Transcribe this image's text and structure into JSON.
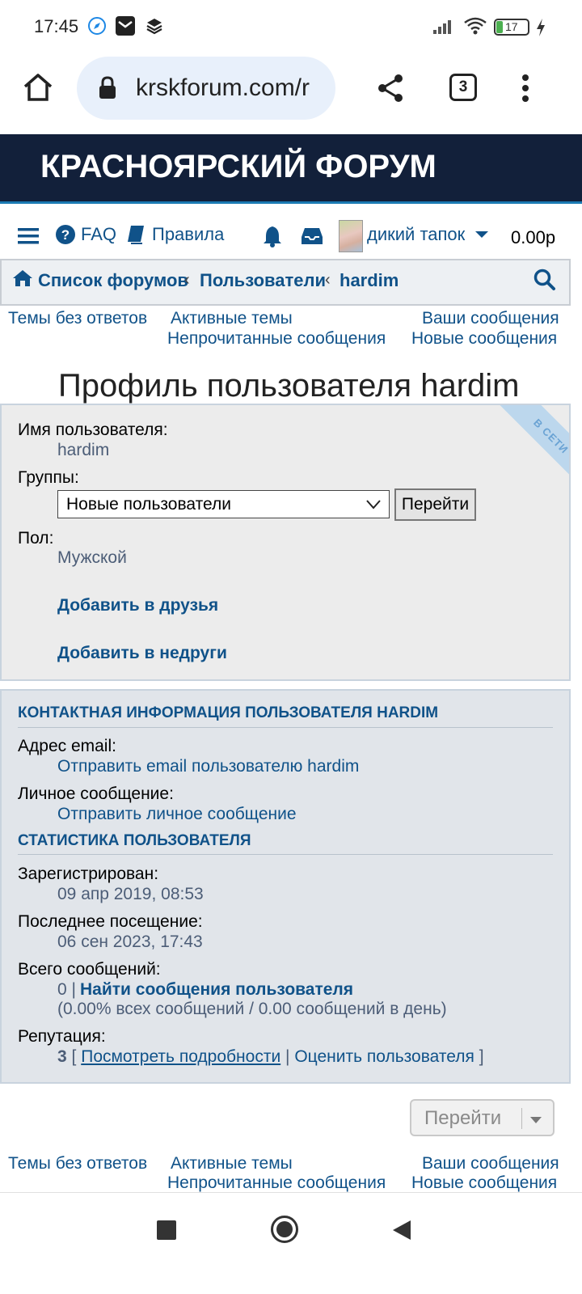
{
  "status_bar": {
    "time": "17:45",
    "battery": "17"
  },
  "browser": {
    "url": "krskforum.com/r",
    "tab_count": "3"
  },
  "forum": {
    "title": "КРАСНОЯРСКИЙ ФОРУМ"
  },
  "nav": {
    "faq": "FAQ",
    "rules": "Правила",
    "username": "дикий тапок",
    "balance": "0.00р"
  },
  "breadcrumb": {
    "home": "Список форумов",
    "sep": "‹",
    "users": "Пользователи",
    "current": "hardim"
  },
  "quick_links": {
    "unanswered": "Темы без ответов",
    "active": "Активные темы",
    "your_posts": "Ваши сообщения",
    "unread": "Непрочитанные сообщения",
    "new_posts": "Новые сообщения"
  },
  "profile": {
    "title": "Профиль пользователя hardim",
    "online_badge": "В СЕТИ",
    "username_label": "Имя пользователя:",
    "username_value": "hardim",
    "groups_label": "Группы:",
    "groups_selected": "Новые пользователи",
    "go_button": "Перейти",
    "gender_label": "Пол:",
    "gender_value": "Мужской",
    "add_friend": "Добавить в друзья",
    "add_foe": "Добавить в недруги"
  },
  "contact": {
    "heading": "КОНТАКТНАЯ ИНФОРМАЦИЯ ПОЛЬЗОВАТЕЛЯ HARDIM",
    "email_label": "Адрес email:",
    "email_link": "Отправить email пользователю hardim",
    "pm_label": "Личное сообщение:",
    "pm_link": "Отправить личное сообщение"
  },
  "stats": {
    "heading": "СТАТИСТИКА ПОЛЬЗОВАТЕЛЯ",
    "registered_label": "Зарегистрирован:",
    "registered_value": "09 апр 2019, 08:53",
    "last_visit_label": "Последнее посещение:",
    "last_visit_value": "06 сен 2023, 17:43",
    "posts_label": "Всего сообщений:",
    "posts_count": "0 |",
    "find_posts": "Найти сообщения пользователя",
    "posts_detail": "(0.00% всех сообщений / 0.00 сообщений в день)",
    "reputation_label": "Репутация:",
    "reputation_value": "3",
    "open_bracket": "[",
    "view_details": "Посмотреть подробности",
    "pipe": "|",
    "rate_user": "Оценить пользователя",
    "close_bracket": "]"
  },
  "jump": {
    "label": "Перейти"
  },
  "colors": {
    "header_bg": "#12203a",
    "link": "#105289",
    "panel_bg": "#ececec",
    "panel2_bg": "#e1e5ea"
  }
}
